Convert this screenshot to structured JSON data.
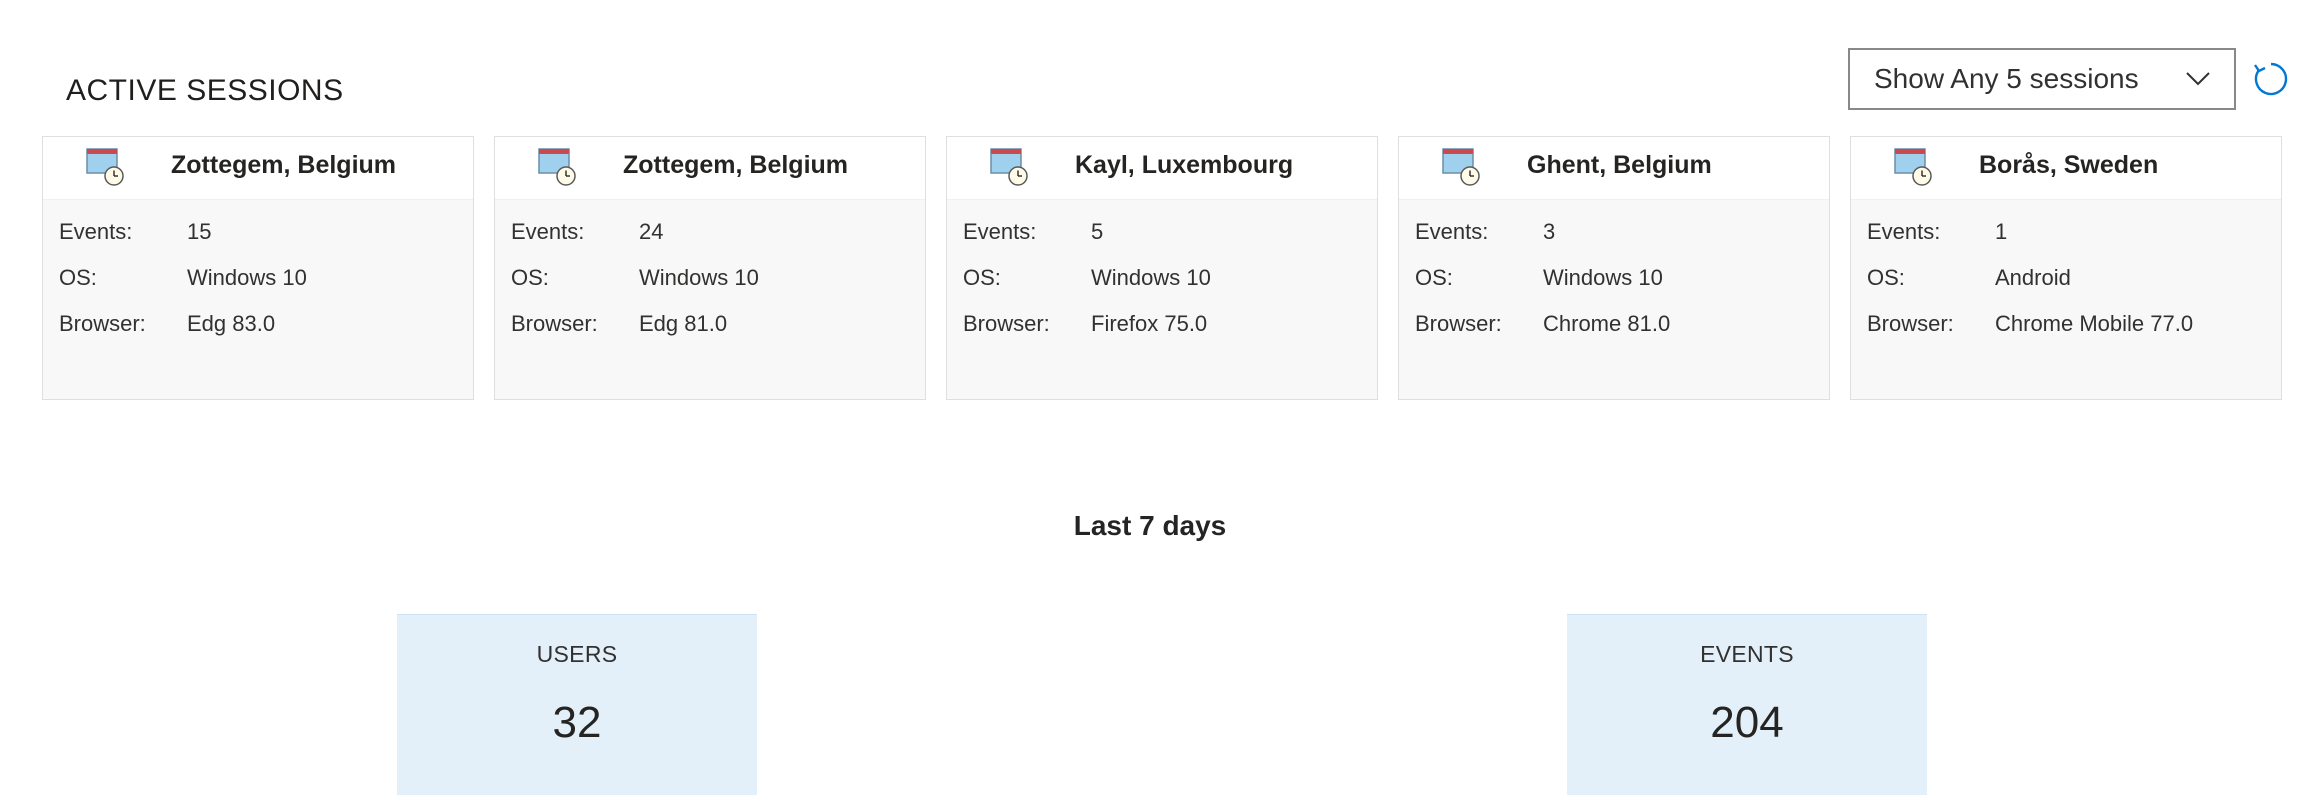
{
  "section": {
    "title": "ACTIVE SESSIONS"
  },
  "filter": {
    "selected": "Show Any 5 sessions"
  },
  "icons": {
    "dropdown": "chevron-down-icon",
    "refresh": "refresh-icon",
    "session": "computer-clock-icon"
  },
  "sessions": [
    {
      "location": "Zottegem, Belgium",
      "events_label": "Events:",
      "events": "15",
      "os_label": "OS:",
      "os": "Windows 10",
      "browser_label": "Browser:",
      "browser": "Edg 83.0"
    },
    {
      "location": "Zottegem, Belgium",
      "events_label": "Events:",
      "events": "24",
      "os_label": "OS:",
      "os": "Windows 10",
      "browser_label": "Browser:",
      "browser": "Edg 81.0"
    },
    {
      "location": "Kayl, Luxembourg",
      "events_label": "Events:",
      "events": "5",
      "os_label": "OS:",
      "os": "Windows 10",
      "browser_label": "Browser:",
      "browser": "Firefox 75.0"
    },
    {
      "location": "Ghent, Belgium",
      "events_label": "Events:",
      "events": "3",
      "os_label": "OS:",
      "os": "Windows 10",
      "browser_label": "Browser:",
      "browser": "Chrome 81.0"
    },
    {
      "location": "Borås, Sweden",
      "events_label": "Events:",
      "events": "1",
      "os_label": "OS:",
      "os": "Android",
      "browser_label": "Browser:",
      "browser": "Chrome Mobile 77.0"
    }
  ],
  "period": {
    "label": "Last 7 days"
  },
  "stats": {
    "users": {
      "label": "USERS",
      "value": "32"
    },
    "events": {
      "label": "EVENTS",
      "value": "204"
    }
  },
  "colors": {
    "accent": "#0078d4",
    "stat_bg": "#e3f0f9",
    "card_bg": "#f8f8f8"
  }
}
